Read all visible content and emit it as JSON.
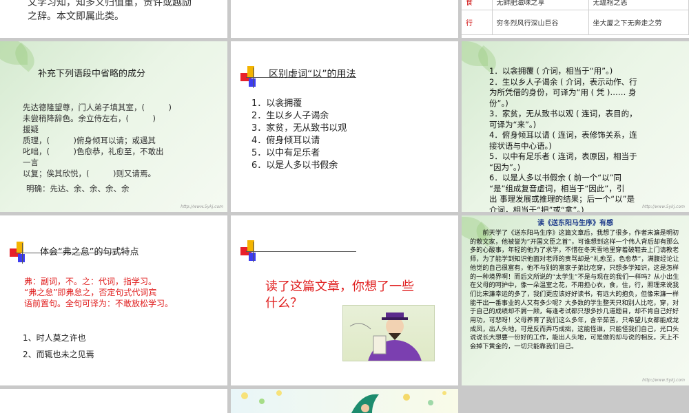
{
  "s1": {
    "lines": [
      "文学习知，知多义归值重，贵许或越励",
      "之辞。本文即属此类。"
    ]
  },
  "s3": {
    "rows": [
      {
        "c1": "食",
        "c2": "无鲜肥滋味之享",
        "c3": "无缊袍之恶"
      },
      {
        "c1": "行",
        "c2": "穷冬烈风行深山巨谷",
        "c3": "坐大厦之下无奔走之劳"
      }
    ]
  },
  "s4": {
    "title": "补充下列语段中省略的成分",
    "lines": [
      "先达德隆望尊，门人弟子填其室，(　　　)",
      "未尝稍降辞色。余立侍左右，(　　　)",
      "援疑",
      "质理，(　　　)俯身倾耳以请；或遇其",
      "叱咄，(　　　)色愈恭，礼愈至，不敢出",
      "一言",
      "以复；俟其欣悦，(　　　)则又请焉。"
    ],
    "answer": "明确：先达、余、余、余、余"
  },
  "s5": {
    "title": "区别虚词“以”的用法",
    "items": [
      "1．以衾拥覆",
      "2．生以乡人子谒余",
      "3．家贫，无从致书以观",
      "4．俯身倾耳以请",
      "5．以中有足乐者",
      "6．以是人多以书假余"
    ]
  },
  "s6": {
    "lines": [
      "1．以衾拥覆 ( 介词，相当于“用”。)",
      "2．生以乡人子谒余 ( 介词，表示动作、行",
      "为所凭借的身份，可译为“用 ( 凭 )…… 身",
      "份”。)",
      "3．家贫，无从致书以观 ( 连词，表目的，",
      "可译为“来”。)",
      "4．俯身倾耳以请 ( 连词，表修饰关系，连",
      "接状语与中心语。)",
      "5．以中有足乐者 ( 连词，表原因，相当于",
      "“因为”。)",
      "6．以是人多以书假余 ( 前一个“以”同",
      "“是”组成复音虚词，相当于“因此”，引",
      "出 事理发展或推理的结果；后一个“以”是",
      "介词，相当于“把”或“拿”。)"
    ]
  },
  "s7": {
    "title": "体会“弗之怠”的句式特点",
    "red": [
      "弗：副词，不。之：代词，指学习。",
      "“弗之怠”即弗怠之，否定句式代词宾",
      "语前置句。全句可译为：不敢放松学习。"
    ],
    "items": [
      "1、时人莫之许也",
      "2、而辄也未之见焉"
    ]
  },
  "s8": {
    "title": [
      "读了这篇文章，你想了一些",
      "什么？"
    ]
  },
  "s9": {
    "title": "读《送东阳马生序》有感",
    "body": "前天学了《送东阳马生序》这篇文章后，我想了很多，作者宋濂是明初的散文家，他被誉为”开国文臣之首”，可谁想到这样一个伟人背后却有那么多的心酸事，年轻的他为了求学，不惜在冬天雪地里穿着破鞋去上门请教老师，为了能学到知识他面对老师的责骂却是“礼愈至，色愈恭”，满腹经论让他觉的自己很富有，他不与别的富家子弟比吃穿，只想多学知识，这是怎样的一种境界啊！而后文所说的“太学生”不是与现在的我们一样吗？从小出生在父母的呵护中，像一朵温室之花，不用担心衣，食，住，行，照理来说我们比宋濂幸运的多了，我们更应该好好读书，有远大的抱负，但像宋濂一样能干出一番事业的人又有多少呢？大多数的学生整天只和别人比吃，穿，对于自己的成绩却不屑一顾，每逢考试都只想多抄几道题目，却不肯自己好好用功，可悲呀！父母养育了我们这么多年，含辛茹苦，只希望儿女都能成龙成凤，出人头地，可是反而弄巧成拙，这能怪谁，只能怪我们自己，光口头说说长大想要一份好的工作，能出人头地，可是做的却与说的相反。天上不会掉下黄金的，一切只能靠我们自己。"
  },
  "watermark": "http://www.5ykj.com"
}
